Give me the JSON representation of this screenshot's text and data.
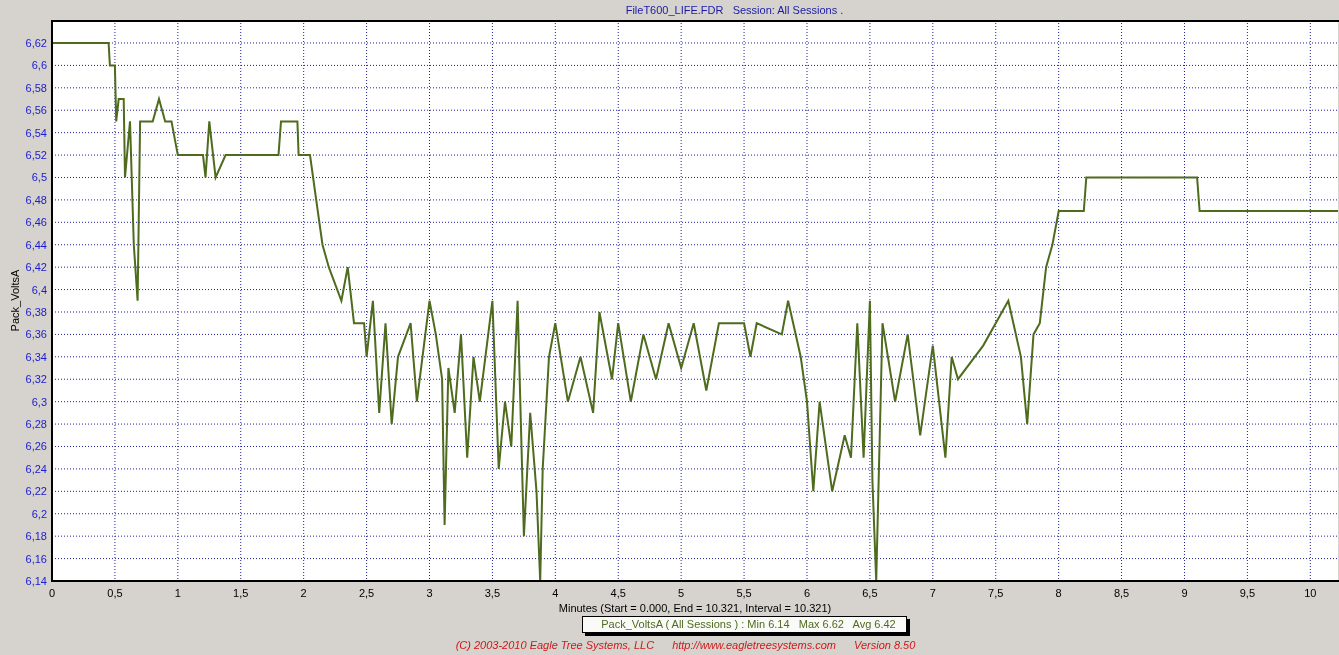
{
  "chart": {
    "chart_data": {
      "type": "line",
      "title": "FileT600_LIFE.FDR   Session: All Sessions .",
      "xlabel": "Minutes (Start = 0.000,  End = 10.321,  Interval =  10.321)",
      "ylabel": "Pack_VoltsA",
      "x": [
        0,
        0.45,
        0.46,
        0.5,
        0.51,
        0.53,
        0.57,
        0.58,
        0.62,
        0.65,
        0.68,
        0.7,
        0.8,
        0.85,
        0.9,
        0.95,
        1.0,
        1.2,
        1.22,
        1.25,
        1.3,
        1.38,
        1.8,
        1.82,
        1.95,
        1.96,
        2.05,
        2.1,
        2.15,
        2.2,
        2.3,
        2.35,
        2.4,
        2.48,
        2.5,
        2.55,
        2.6,
        2.65,
        2.7,
        2.75,
        2.85,
        2.9,
        3.0,
        3.05,
        3.1,
        3.12,
        3.15,
        3.2,
        3.25,
        3.3,
        3.35,
        3.4,
        3.5,
        3.55,
        3.6,
        3.65,
        3.7,
        3.75,
        3.8,
        3.85,
        3.88,
        3.9,
        3.95,
        4.0,
        4.1,
        4.2,
        4.3,
        4.35,
        4.45,
        4.5,
        4.6,
        4.7,
        4.8,
        4.9,
        5.0,
        5.1,
        5.2,
        5.3,
        5.5,
        5.55,
        5.6,
        5.8,
        5.85,
        5.95,
        6.0,
        6.05,
        6.1,
        6.2,
        6.3,
        6.35,
        6.4,
        6.45,
        6.5,
        6.52,
        6.55,
        6.6,
        6.7,
        6.8,
        6.9,
        7.0,
        7.1,
        7.15,
        7.2,
        7.4,
        7.5,
        7.6,
        7.7,
        7.75,
        7.8,
        7.85,
        7.9,
        7.95,
        8.0,
        8.2,
        8.22,
        9.1,
        9.12,
        10.22
      ],
      "series": [
        {
          "name": "Pack_VoltsA",
          "color": "#4e6b1e",
          "values": [
            6.62,
            6.62,
            6.6,
            6.6,
            6.55,
            6.57,
            6.57,
            6.5,
            6.55,
            6.44,
            6.39,
            6.55,
            6.55,
            6.57,
            6.55,
            6.55,
            6.52,
            6.52,
            6.5,
            6.55,
            6.5,
            6.52,
            6.52,
            6.55,
            6.55,
            6.52,
            6.52,
            6.48,
            6.44,
            6.42,
            6.39,
            6.42,
            6.37,
            6.37,
            6.34,
            6.39,
            6.29,
            6.37,
            6.28,
            6.34,
            6.37,
            6.3,
            6.39,
            6.36,
            6.32,
            6.19,
            6.33,
            6.29,
            6.36,
            6.25,
            6.34,
            6.3,
            6.39,
            6.24,
            6.3,
            6.26,
            6.39,
            6.18,
            6.29,
            6.22,
            6.14,
            6.24,
            6.34,
            6.37,
            6.3,
            6.34,
            6.29,
            6.38,
            6.32,
            6.37,
            6.3,
            6.36,
            6.32,
            6.37,
            6.33,
            6.37,
            6.31,
            6.37,
            6.37,
            6.34,
            6.37,
            6.36,
            6.39,
            6.34,
            6.3,
            6.22,
            6.3,
            6.22,
            6.27,
            6.25,
            6.37,
            6.25,
            6.39,
            6.23,
            6.14,
            6.37,
            6.3,
            6.36,
            6.27,
            6.35,
            6.25,
            6.34,
            6.32,
            6.35,
            6.37,
            6.39,
            6.34,
            6.28,
            6.36,
            6.37,
            6.42,
            6.44,
            6.47,
            6.47,
            6.5,
            6.5,
            6.47,
            6.47
          ]
        }
      ],
      "grid": true,
      "xlim": [
        0,
        10.22
      ],
      "ylim": [
        6.14,
        6.6405
      ],
      "xticks": [
        {
          "value": 0,
          "label": "0"
        },
        {
          "value": 0.5,
          "label": "0,5"
        },
        {
          "value": 1,
          "label": "1"
        },
        {
          "value": 1.5,
          "label": "1,5"
        },
        {
          "value": 2,
          "label": "2"
        },
        {
          "value": 2.5,
          "label": "2,5"
        },
        {
          "value": 3,
          "label": "3"
        },
        {
          "value": 3.5,
          "label": "3,5"
        },
        {
          "value": 4,
          "label": "4"
        },
        {
          "value": 4.5,
          "label": "4,5"
        },
        {
          "value": 5,
          "label": "5"
        },
        {
          "value": 5.5,
          "label": "5,5"
        },
        {
          "value": 6,
          "label": "6"
        },
        {
          "value": 6.5,
          "label": "6,5"
        },
        {
          "value": 7,
          "label": "7"
        },
        {
          "value": 7.5,
          "label": "7,5"
        },
        {
          "value": 8,
          "label": "8"
        },
        {
          "value": 8.5,
          "label": "8,5"
        },
        {
          "value": 9,
          "label": "9"
        },
        {
          "value": 9.5,
          "label": "9,5"
        },
        {
          "value": 10,
          "label": "10"
        }
      ],
      "yticks": [
        {
          "value": 6.14,
          "label": "6,14"
        },
        {
          "value": 6.16,
          "label": "6,16"
        },
        {
          "value": 6.18,
          "label": "6,18"
        },
        {
          "value": 6.2,
          "label": "6,2"
        },
        {
          "value": 6.22,
          "label": "6,22"
        },
        {
          "value": 6.24,
          "label": "6,24"
        },
        {
          "value": 6.26,
          "label": "6,26"
        },
        {
          "value": 6.28,
          "label": "6,28"
        },
        {
          "value": 6.3,
          "label": "6,3"
        },
        {
          "value": 6.32,
          "label": "6,32"
        },
        {
          "value": 6.34,
          "label": "6,34"
        },
        {
          "value": 6.36,
          "label": "6,36"
        },
        {
          "value": 6.38,
          "label": "6,38"
        },
        {
          "value": 6.4,
          "label": "6,4"
        },
        {
          "value": 6.42,
          "label": "6,42"
        },
        {
          "value": 6.44,
          "label": "6,44"
        },
        {
          "value": 6.46,
          "label": "6,46"
        },
        {
          "value": 6.48,
          "label": "6,48"
        },
        {
          "value": 6.5,
          "label": "6,5"
        },
        {
          "value": 6.52,
          "label": "6,52"
        },
        {
          "value": 6.54,
          "label": "6,54"
        },
        {
          "value": 6.56,
          "label": "6,56"
        },
        {
          "value": 6.58,
          "label": "6,58"
        },
        {
          "value": 6.6,
          "label": "6,6"
        },
        {
          "value": 6.62,
          "label": "6,62"
        }
      ]
    }
  },
  "legend": {
    "text": "( All Sessions ) : Min 6.14   Max 6.62   Avg 6.42"
  },
  "footer": {
    "copyright": "(C) 2003-2010 Eagle Tree Systems, LLC",
    "link": "http://www.eagletreesystems.com",
    "version": "Version 8.50"
  }
}
